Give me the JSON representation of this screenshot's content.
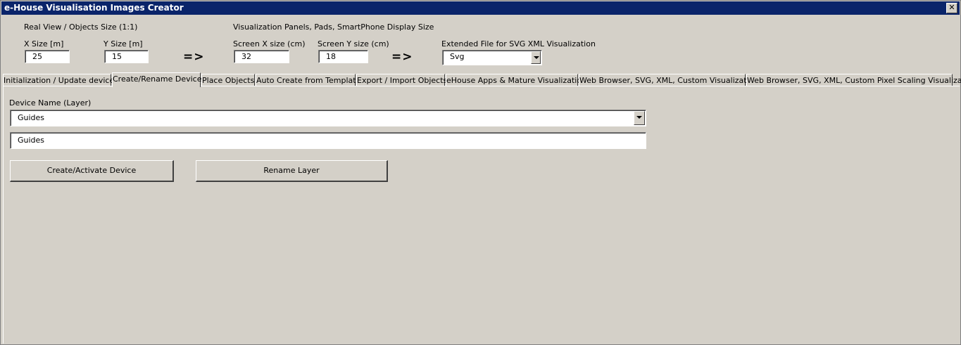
{
  "window": {
    "title": "e-House Visualisation Images Creator",
    "close_label": "✕"
  },
  "real_view": {
    "heading": "Real View / Objects Size (1:1)",
    "x_label": "X Size [m]",
    "x_value": "25",
    "y_label": "Y Size [m]",
    "y_value": "15"
  },
  "screen": {
    "heading": "Visualization Panels, Pads, SmartPhone Display Size",
    "x_label": "Screen X size (cm)",
    "x_value": "32",
    "y_label": "Screen Y size (cm)",
    "y_value": "18"
  },
  "arrows": {
    "first": "=>",
    "second": "=>"
  },
  "extended": {
    "label": "Extended File for SVG XML Visualization",
    "value": "Svg"
  },
  "tabs": [
    {
      "label": "Initialization / Update devices"
    },
    {
      "label": "Create/Rename Device"
    },
    {
      "label": "Place Objects"
    },
    {
      "label": "Auto Create from Template"
    },
    {
      "label": "Export / Import Objects"
    },
    {
      "label": "eHouse Apps & Mature Visualizations"
    },
    {
      "label": "Web Browser, SVG, XML, Custom Visualizations"
    },
    {
      "label": "Web Browser, SVG, XML, Custom Pixel Scaling Visualization"
    }
  ],
  "active_tab": "Create/Rename Device",
  "device": {
    "name_label": "Device Name (Layer)",
    "selected": "Guides",
    "rename_value": "Guides"
  },
  "buttons": {
    "create": "Create/Activate Device",
    "rename": "Rename Layer"
  }
}
